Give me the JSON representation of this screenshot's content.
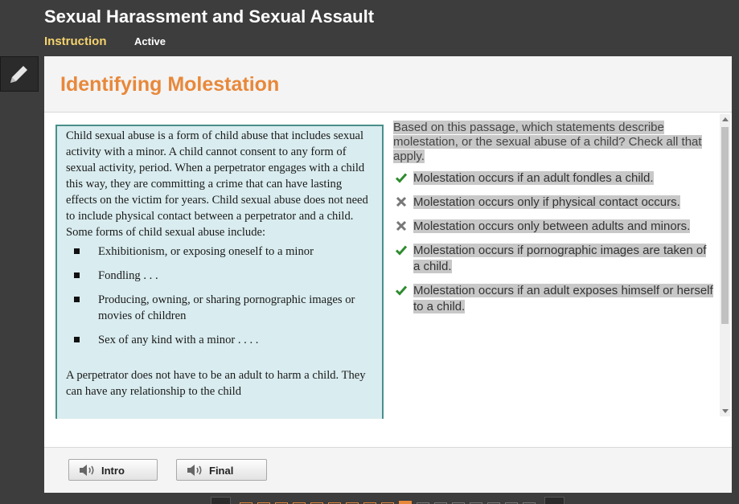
{
  "header": {
    "course_title": "Sexual Harassment and Sexual Assault",
    "tabs": [
      {
        "label": "Instruction"
      },
      {
        "label": "Active"
      }
    ]
  },
  "page": {
    "title": "Identifying Molestation"
  },
  "passage": {
    "intro": "Child sexual abuse is a form of child abuse that includes sexual activity with a minor. A child cannot consent to any form of sexual activity, period. When a perpetrator engages with a child this way, they are committing a crime that can have lasting effects on the victim for years. Child sexual abuse does not need to include physical contact between a perpetrator and a child. Some forms of child sexual abuse include:",
    "bullets": [
      "Exhibitionism, or exposing oneself to a minor",
      "Fondling . . .",
      "Producing, owning, or sharing pornographic images or movies of children",
      "Sex of any kind with a minor . . . ."
    ],
    "after": "A perpetrator does not have to be an adult to harm a child. They can have any relationship to the child"
  },
  "question": {
    "prompt": "Based on this passage, which statements describe molestation, or the sexual abuse of a child? Check all that apply.",
    "options": [
      {
        "text": "Molestation occurs if an adult fondles a child.",
        "result": "correct",
        "icon": "check-icon"
      },
      {
        "text": "Molestation occurs only if physical contact occurs.",
        "result": "incorrect",
        "icon": "x-icon"
      },
      {
        "text": "Molestation occurs only between adults and minors.",
        "result": "incorrect",
        "icon": "x-icon"
      },
      {
        "text": "Molestation occurs if pornographic images are taken of a child.",
        "result": "correct",
        "icon": "check-icon"
      },
      {
        "text": "Molestation occurs if an adult exposes himself or herself to a child.",
        "result": "correct",
        "icon": "check-icon"
      }
    ]
  },
  "footer": {
    "intro_label": "Intro",
    "final_label": "Final"
  },
  "colors": {
    "accent": "#e8883a",
    "tab_highlight": "#f5d36e",
    "check": "#2e8b2e",
    "x": "#777777"
  }
}
